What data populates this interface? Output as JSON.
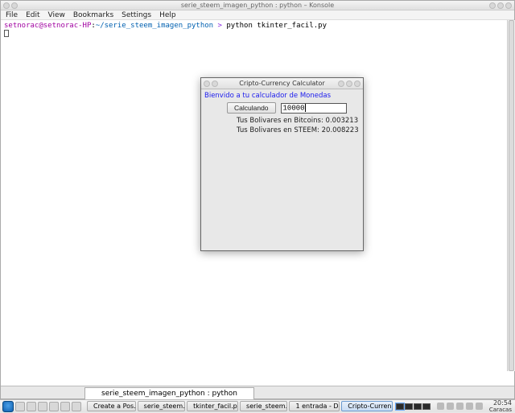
{
  "konsole": {
    "window_title": "serie_steem_imagen_python : python – Konsole",
    "menu": [
      "File",
      "Edit",
      "View",
      "Bookmarks",
      "Settings",
      "Help"
    ],
    "prompt_user": "setnorac@setnorac-HP",
    "prompt_sep": ":",
    "prompt_path": "~/serie_steem_imagen_python",
    "prompt_arrow": ">",
    "command": "python tkinter_facil.py",
    "tab_label": "serie_steem_imagen_python : python"
  },
  "dialog": {
    "title": "Cripto-Currency Calculator",
    "welcome": "Bienvido a tu calculador de Monedas",
    "button_label": "Calculando",
    "entry_value": "10000",
    "result_btc_label": "Tus Bolivares en Bitcoins:",
    "result_btc_value": "0.003213",
    "result_steem_label": "Tus Bolivares en STEEM:",
    "result_steem_value": "20.008223"
  },
  "taskbar": {
    "items": [
      {
        "label": "Create a Pos…"
      },
      {
        "label": "serie_steem…"
      },
      {
        "label": "tkinter_facil.p…"
      },
      {
        "label": "serie_steem…"
      },
      {
        "label": "1 entrada - D…"
      },
      {
        "label": "Cripto-Curren…"
      }
    ],
    "clock_time": "20:54",
    "clock_tz": "Caracas"
  }
}
